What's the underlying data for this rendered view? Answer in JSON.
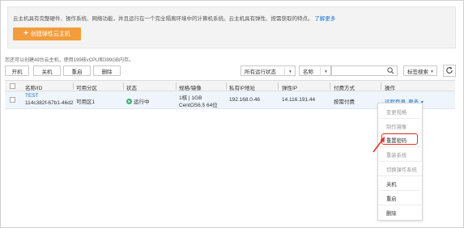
{
  "intro": {
    "text": "云主机具有完整硬件、操作系统、网络功能，并且运行在一个完全隔离环境中的计算机系统。云主机具有弹性、按需获取的特点。",
    "learn_more": "了解更多",
    "create_button": "创建弹性云主机",
    "plus_icon": "+"
  },
  "quota_text": "您还可以创建49台云主机，使用199核vCPU和399GB内存。",
  "toolbar": {
    "power_on": "开机",
    "power_off": "关机",
    "restart": "重启",
    "delete": "删除",
    "status_filter": "所有运行状态",
    "name_filter": "名称",
    "tag_search": "标签搜索",
    "search_placeholder": ""
  },
  "table": {
    "headers": [
      "名称/ID",
      "可用分区",
      "状态",
      "规格/镜像",
      "私有IP地址",
      "弹性IP",
      "付费方式",
      "操作"
    ],
    "rows": [
      {
        "name": "TEST",
        "id": "114c382f-67b1-46d2",
        "zone": "可用区1",
        "status": "运行中",
        "spec": "1核 | 1GB",
        "image": "CentOS6.5 64位",
        "private_ip": "192.168.0.46",
        "eip": "14.116.191.44",
        "billing": "按需付费",
        "action_remote": "远程登录",
        "action_more": "更多"
      }
    ]
  },
  "more_menu": {
    "items": [
      {
        "label": "变更规格",
        "enabled": false
      },
      {
        "label": "制作镜像",
        "enabled": false
      },
      {
        "label": "重置密码",
        "enabled": true
      },
      {
        "label": "重装系统",
        "enabled": false
      },
      {
        "label": "切换操作系统",
        "enabled": false
      },
      {
        "label": "关机",
        "enabled": true
      },
      {
        "label": "重启",
        "enabled": true
      },
      {
        "label": "删除",
        "enabled": true
      }
    ],
    "highlighted_item": "重置密码"
  },
  "colors": {
    "accent_orange": "#f39c3c",
    "link_blue": "#1a73c9",
    "status_green": "#3ab46e",
    "highlight_red": "#e2342a"
  }
}
